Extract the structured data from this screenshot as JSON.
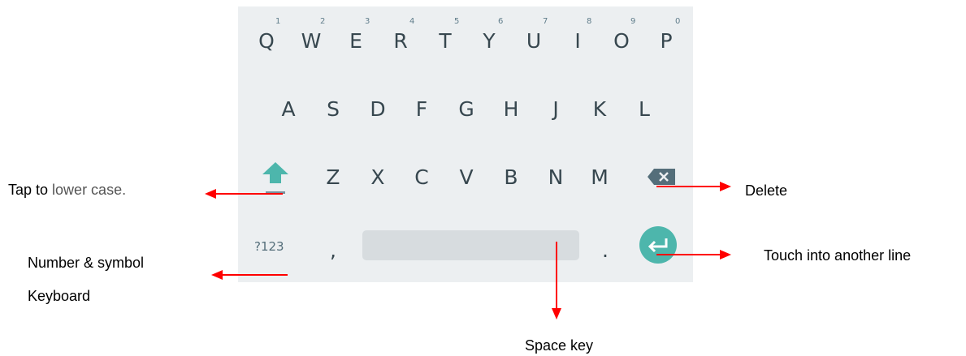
{
  "keyboard": {
    "row1": [
      {
        "letter": "Q",
        "hint": "1"
      },
      {
        "letter": "W",
        "hint": "2"
      },
      {
        "letter": "E",
        "hint": "3"
      },
      {
        "letter": "R",
        "hint": "4"
      },
      {
        "letter": "T",
        "hint": "5"
      },
      {
        "letter": "Y",
        "hint": "6"
      },
      {
        "letter": "U",
        "hint": "7"
      },
      {
        "letter": "I",
        "hint": "8"
      },
      {
        "letter": "O",
        "hint": "9"
      },
      {
        "letter": "P",
        "hint": "0"
      }
    ],
    "row2": [
      "A",
      "S",
      "D",
      "F",
      "G",
      "H",
      "J",
      "K",
      "L"
    ],
    "row3": [
      "Z",
      "X",
      "C",
      "V",
      "B",
      "N",
      "M"
    ],
    "symbols_label": "?123",
    "comma": ",",
    "period": ".",
    "colors": {
      "background": "#eceff1",
      "accent": "#4db6ac",
      "key_text": "#37474f"
    },
    "icons": {
      "shift": "shift-up-arrow-icon",
      "delete": "backspace-icon",
      "enter": "enter-return-icon"
    }
  },
  "annotations": {
    "shift_prefix": "Tap to ",
    "shift_suffix": "lower case.",
    "delete": "Delete",
    "symbols_line1": "Number & symbol",
    "symbols_line2": "Keyboard",
    "enter": "Touch into another line",
    "space": "Space key"
  },
  "colors": {
    "arrow": "#ff0000"
  }
}
